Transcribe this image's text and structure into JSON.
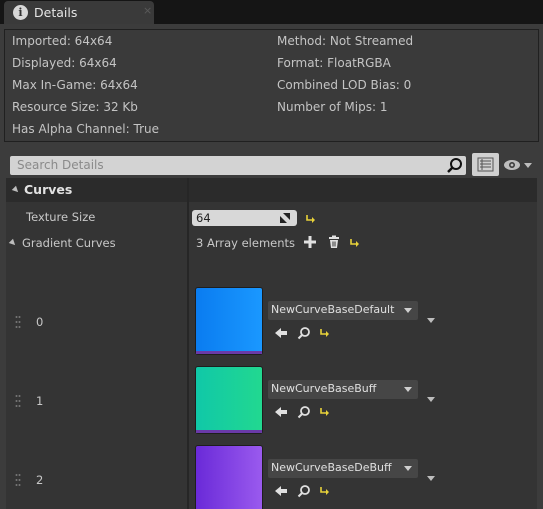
{
  "tab": {
    "title": "Details",
    "icon": "info-icon",
    "close": "×"
  },
  "info": {
    "imported": "Imported: 64x64",
    "displayed": "Displayed: 64x64",
    "max_in_game": "Max In-Game: 64x64",
    "resource_size": "Resource Size: 32 Kb",
    "has_alpha": "Has Alpha Channel: True",
    "method": "Method: Not Streamed",
    "format": "Format: FloatRGBA",
    "lod_bias": "Combined LOD Bias: 0",
    "num_mips": "Number of Mips: 1"
  },
  "search": {
    "placeholder": "Search Details"
  },
  "category": {
    "label": "Curves"
  },
  "texture_size": {
    "label": "Texture Size",
    "value": "64"
  },
  "gradient_curves": {
    "label": "Gradient Curves",
    "count_text": "3 Array elements",
    "items": [
      {
        "index": "0",
        "curve": "NewCurveBaseDefault",
        "color_a": "#0a7cf0",
        "color_b": "#1a98ff"
      },
      {
        "index": "1",
        "curve": "NewCurveBaseBuff",
        "color_a": "#10c8a8",
        "color_b": "#22d890"
      },
      {
        "index": "2",
        "curve": "NewCurveBaseDeBuff",
        "color_a": "#6a2ad8",
        "color_b": "#9a5aee"
      }
    ]
  },
  "colors": {
    "reset_arrow": "#e8d23a",
    "tab_bg": "#3a3a3a",
    "panel_bg": "#3c3c3c"
  }
}
